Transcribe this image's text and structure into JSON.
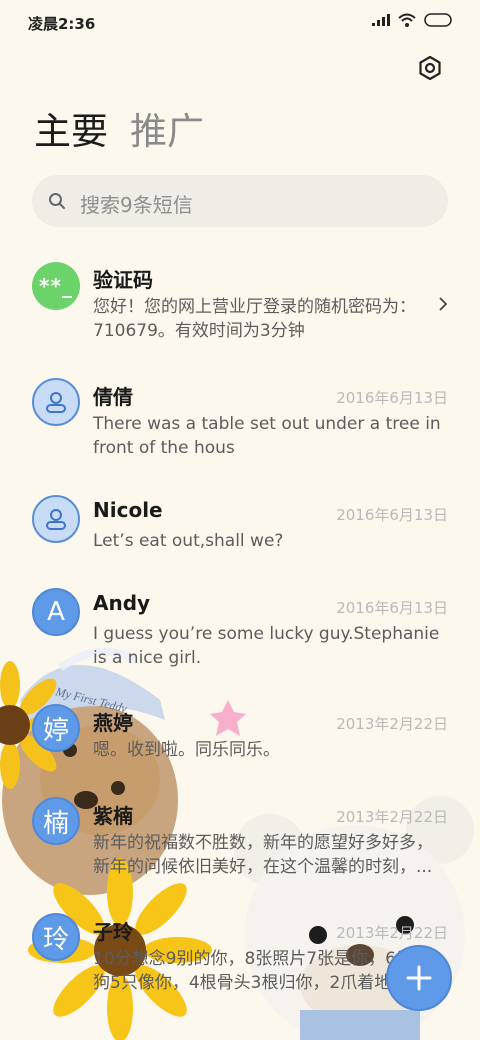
{
  "status": {
    "time": "凌晨2:36"
  },
  "tabs": {
    "primary": "主要",
    "promo": "推广"
  },
  "search": {
    "placeholder": "搜索9条短信"
  },
  "messages": [
    {
      "name": "验证码",
      "date": "",
      "avatar": "**_",
      "avatar_type": "code",
      "snippet": "您好！您的网上营业厅登录的随机密码为：710679。有效时间为3分钟"
    },
    {
      "name": "倩倩",
      "date": "2016年6月13日",
      "avatar": "",
      "avatar_type": "contact",
      "snippet": "There was a table set out under a tree in front of the hous"
    },
    {
      "name": "Nicole",
      "date": "2016年6月13日",
      "avatar": "",
      "avatar_type": "contact",
      "snippet": "Let’s eat out,shall we?"
    },
    {
      "name": "Andy",
      "date": "2016年6月13日",
      "avatar": "A",
      "avatar_type": "letter",
      "snippet": "I guess you’re some lucky guy.Stephanie is a nice girl."
    },
    {
      "name": "燕婷",
      "date": "2013年2月22日",
      "avatar": "婷",
      "avatar_type": "letter",
      "snippet": "嗯。收到啦。同乐同乐。"
    },
    {
      "name": "紫楠",
      "date": "2013年2月22日",
      "avatar": "楠",
      "avatar_type": "letter",
      "snippet": "新年的祝福数不胜数，新年的愿望好多好多，新年的问候依旧美好，在这个温馨的时刻，..."
    },
    {
      "name": "子玲",
      "date": "2013年2月22日",
      "avatar": "玲",
      "avatar_type": "letter",
      "snippet": "10分想念9别的你，8张照片7张是你，6只小狗5只像你，4根骨头3根归你，2爪着地..."
    }
  ],
  "wallpaper": {
    "cap_text": "My First Teddy"
  },
  "colors": {
    "background": "#fdf8ee",
    "accent": "#5f9ae8",
    "code_avatar": "#6cd26a"
  },
  "icons": {
    "settings": "settings-icon",
    "search": "search-icon",
    "fab": "plus-icon"
  }
}
